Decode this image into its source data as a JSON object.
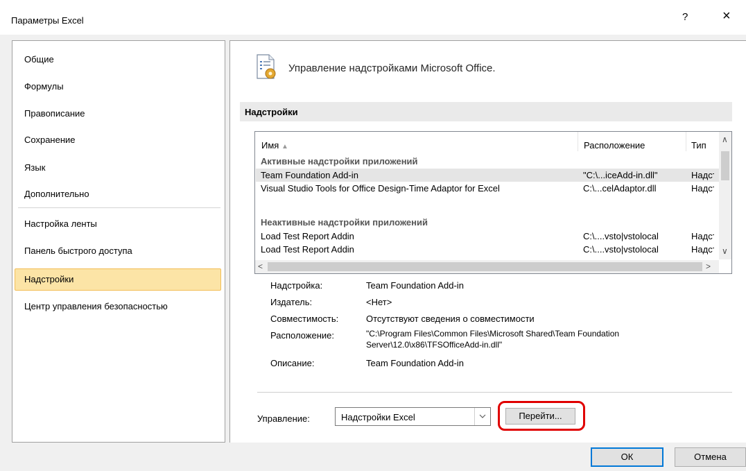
{
  "window": {
    "title": "Параметры Excel",
    "help": "?",
    "close": "×"
  },
  "sidebar": {
    "items": [
      {
        "label": "Общие"
      },
      {
        "label": "Формулы"
      },
      {
        "label": "Правописание"
      },
      {
        "label": "Сохранение"
      },
      {
        "label": "Язык"
      },
      {
        "label": "Дополнительно"
      },
      {
        "label": "Настройка ленты"
      },
      {
        "label": "Панель быстрого доступа"
      },
      {
        "label": "Надстройки"
      },
      {
        "label": "Центр управления безопасностью"
      }
    ],
    "selected": "Надстройки"
  },
  "main": {
    "header": "Управление надстройками Microsoft Office.",
    "section": "Надстройки",
    "columns": {
      "name": "Имя",
      "sort_indicator": "▲",
      "location": "Расположение",
      "type": "Тип"
    },
    "groups": {
      "active": "Активные надстройки приложений",
      "inactive": "Неактивные надстройки приложений"
    },
    "rows": [
      {
        "name": "Team Foundation Add-in",
        "location": "\"C:\\...iceAdd-in.dll\"",
        "type": "Надстройка"
      },
      {
        "name": "Visual Studio Tools for Office Design-Time Adaptor for Excel",
        "location": "C:\\...celAdaptor.dll",
        "type": "Надстройка"
      },
      {
        "name": "Load Test Report Addin",
        "location": "C:\\....vsto|vstolocal",
        "type": "Надстройка"
      },
      {
        "name": "Load Test Report Addin",
        "location": "C:\\....vsto|vstolocal",
        "type": "Надстройка"
      }
    ],
    "details": {
      "addin_label": "Надстройка:",
      "addin_value": "Team Foundation Add-in",
      "publisher_label": "Издатель:",
      "publisher_value": "<Нет>",
      "compat_label": "Совместимость:",
      "compat_value": "Отсутствуют сведения о совместимости",
      "location_label": "Расположение:",
      "location_value_1": "\"C:\\Program Files\\Common Files\\Microsoft Shared\\Team Foundation",
      "location_value_2": "Server\\12.0\\x86\\TFSOfficeAdd-in.dll\"",
      "desc_label": "Описание:",
      "desc_value": "Team Foundation Add-in"
    },
    "manage": {
      "label": "Управление:",
      "selected": "Надстройки Excel",
      "go": "Перейти..."
    }
  },
  "footer": {
    "ok": "ОК",
    "cancel": "Отмена"
  },
  "colors": {
    "selection_fill": "#fce4a6",
    "selection_border": "#f2bd55",
    "highlight_ring": "#e00000",
    "default_button_border": "#0078d7"
  }
}
